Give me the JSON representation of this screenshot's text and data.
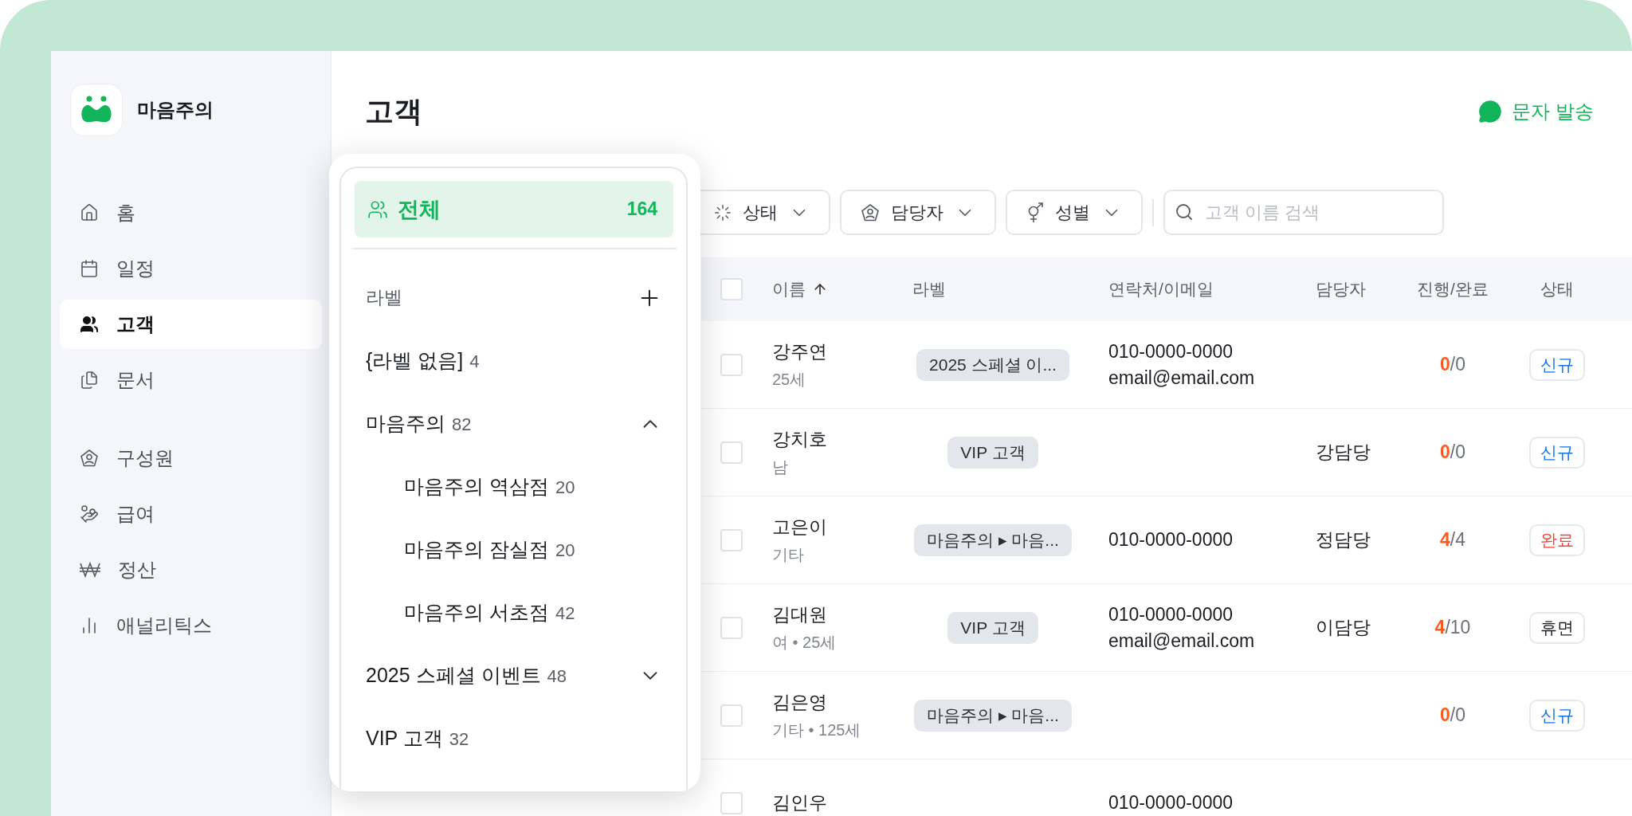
{
  "brand": {
    "name": "마음주의"
  },
  "nav_groups": [
    {
      "items": [
        {
          "label": "홈",
          "selected": false
        },
        {
          "label": "일정",
          "selected": false
        },
        {
          "label": "고객",
          "selected": true
        },
        {
          "label": "문서",
          "selected": false
        }
      ]
    },
    {
      "items": [
        {
          "label": "구성원",
          "selected": false
        },
        {
          "label": "급여",
          "selected": false
        },
        {
          "label": "정산",
          "selected": false
        },
        {
          "label": "애널리틱스",
          "selected": false
        }
      ]
    }
  ],
  "page": {
    "title": "고객",
    "action": "문자 발송"
  },
  "filters": [
    {
      "label": "상태"
    },
    {
      "label": "담당자"
    },
    {
      "label": "성별"
    }
  ],
  "search": {
    "placeholder": "고객 이름 검색"
  },
  "table": {
    "header_checked": false,
    "columns": [
      {
        "label": "이름",
        "sorted": true
      },
      {
        "label": "라벨"
      },
      {
        "label": "연락처/이메일"
      },
      {
        "label": "담당자"
      },
      {
        "label": "진행/완료"
      },
      {
        "label": "상태"
      }
    ],
    "rows": [
      {
        "checked": false,
        "name": "강주연",
        "info": "25세",
        "label": "2025 스페셜 이...",
        "phone": "010-0000-0000",
        "email": "email@email.com",
        "progress": "**0**/0",
        "status": {
          "text": "신규",
          "kind": "new"
        }
      },
      {
        "checked": false,
        "name": "강치호",
        "info": "남",
        "label": "VIP 고객",
        "manager": "강담당",
        "progress": "**0**/0",
        "status": {
          "text": "신규",
          "kind": "new"
        }
      },
      {
        "checked": false,
        "name": "고은이",
        "info": "기타",
        "label": "마음주의 ▸ 마음...",
        "phone": "010-0000-0000",
        "manager": "정담당",
        "progress": "**4**/4",
        "status": {
          "text": "완료",
          "kind": "done"
        }
      },
      {
        "checked": false,
        "name": "김대원",
        "info": "여 • 25세",
        "label": "VIP 고객",
        "phone": "010-0000-0000",
        "email": "email@email.com",
        "manager": "이담당",
        "progress": "**4**/10",
        "status": {
          "text": "휴면",
          "kind": "dormant"
        }
      },
      {
        "checked": false,
        "name": "김은영",
        "info": "기타 • 125세",
        "label": "마음주의 ▸ 마음...",
        "progress": "**0**/0",
        "status": {
          "text": "신규",
          "kind": "new"
        }
      },
      {
        "checked": false,
        "name": "김인우",
        "phone": "010-0000-0000"
      }
    ]
  },
  "label_menu": {
    "all": {
      "label": "전체",
      "count": "164",
      "selected": true
    },
    "section_title": "라벨",
    "items": [
      {
        "label": "{라벨 없음]",
        "count": "4",
        "selected": false
      },
      {
        "label": "마음주의",
        "count": "82",
        "selected": false,
        "expanded": true,
        "children": [
          {
            "label": "마음주의 역삼점",
            "count": "20",
            "selected": false
          },
          {
            "label": "마음주의 잠실점",
            "count": "20",
            "selected": false
          },
          {
            "label": "마음주의 서초점",
            "count": "42",
            "selected": false
          }
        ]
      },
      {
        "label": "2025 스페셜 이벤트",
        "count": "48",
        "selected": false,
        "expanded": false
      },
      {
        "label": "VIP 고객",
        "count": "32",
        "selected": false
      }
    ]
  }
}
